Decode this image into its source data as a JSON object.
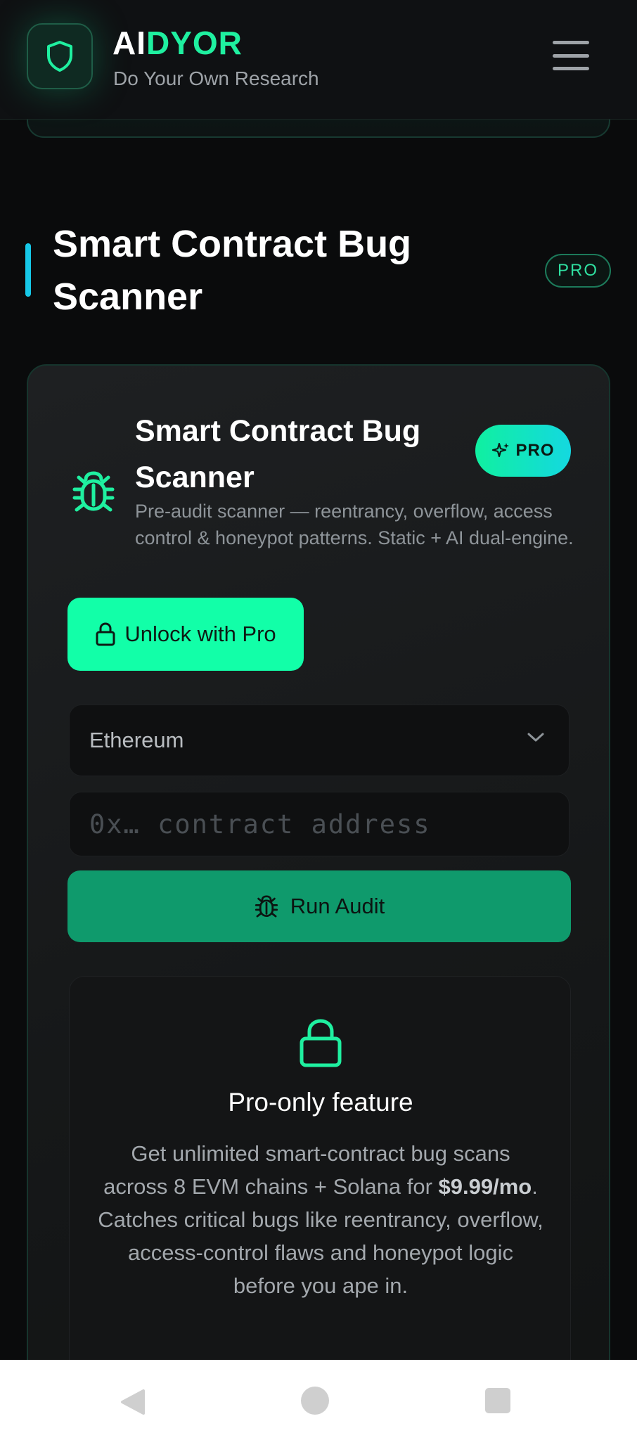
{
  "header": {
    "brand_prefix": "AI",
    "brand_suffix": "DYOR",
    "tagline": "Do Your Own Research"
  },
  "section": {
    "title": "Smart Contract Bug Scanner",
    "badge": "PRO"
  },
  "card": {
    "title": "Smart Contract Bug Scanner",
    "pro_badge": "PRO",
    "description": "Pre-audit scanner — reentrancy, overflow, access control & honeypot patterns. Static + AI dual-engine.",
    "unlock_label": "Unlock with Pro",
    "chain_selected": "Ethereum",
    "address_placeholder": "0x… contract address",
    "run_label": "Run Audit"
  },
  "pro_notice": {
    "title": "Pro-only feature",
    "text_before": "Get unlimited smart-contract bug scans across 8 EVM chains + Solana for ",
    "price": "$9.99/mo",
    "text_after": ". Catches critical bugs like reentrancy, overflow, access-control flaws and honeypot logic before you ape in."
  },
  "colors": {
    "accent_green": "#12ffa8",
    "accent_cyan": "#16c8e8",
    "run_button": "#0f9a6c",
    "background": "#0a0b0c"
  },
  "icons": [
    "shield-icon",
    "menu-icon",
    "bug-icon",
    "sparkle-icon",
    "lock-icon",
    "chevron-down-icon",
    "nav-back-icon",
    "nav-home-icon",
    "nav-recents-icon"
  ]
}
